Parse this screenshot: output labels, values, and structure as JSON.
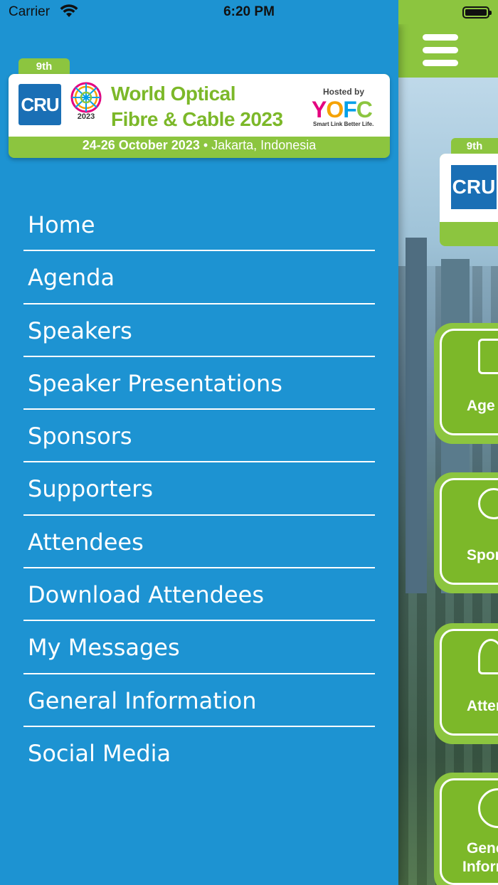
{
  "status_bar": {
    "carrier": "Carrier",
    "time": "6:20 PM",
    "battery_level": 1.0
  },
  "banner": {
    "edition": "9th",
    "cru_logo_text": "CRU",
    "globe_year": "2023",
    "title_line1": "World Optical",
    "title_line2": "Fibre & Cable 2023",
    "hosted_by": "Hosted by",
    "host_logo_text": "YOFC",
    "host_tagline": "Smart Link Better Life.",
    "date_bold": "24-26 October 2023",
    "separator": " • ",
    "location": "Jakarta, Indonesia"
  },
  "menu": {
    "items": [
      {
        "label": "Home"
      },
      {
        "label": "Agenda"
      },
      {
        "label": "Speakers"
      },
      {
        "label": "Speaker Presentations"
      },
      {
        "label": "Sponsors"
      },
      {
        "label": "Supporters"
      },
      {
        "label": "Attendees"
      },
      {
        "label": "Download Attendees"
      },
      {
        "label": "My Messages"
      },
      {
        "label": "General Information"
      },
      {
        "label": "Social Media"
      }
    ]
  },
  "background_app": {
    "edition": "9th",
    "cru_logo_text": "CRU",
    "tiles": [
      {
        "label": "Age",
        "icon": "clipboard-icon"
      },
      {
        "label": "Spon",
        "icon": "badge-icon"
      },
      {
        "label": "Atten",
        "icon": "people-icon"
      },
      {
        "label": "Gene",
        "label2": "Inform",
        "icon": "info-icon"
      }
    ]
  },
  "colors": {
    "drawer_blue": "#1d93d2",
    "brand_green": "#8cc53f",
    "cru_blue": "#1a6fb5"
  }
}
